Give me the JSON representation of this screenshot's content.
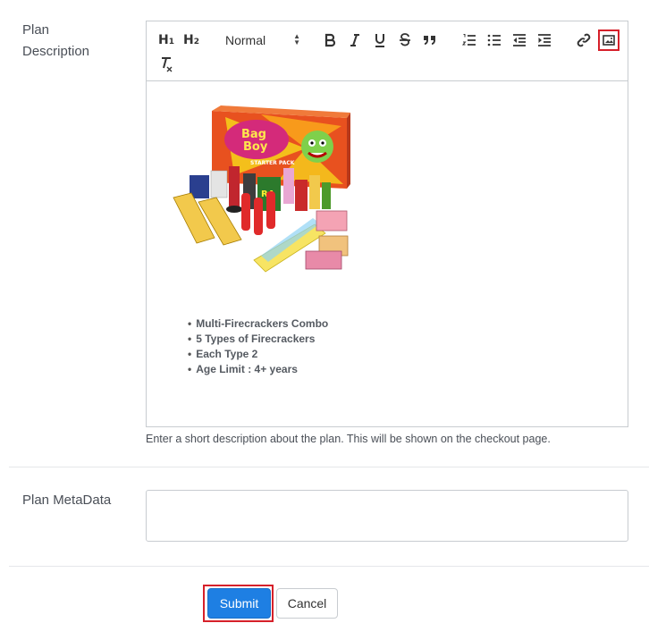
{
  "form": {
    "plan_description_label": "Plan\nDescription",
    "plan_description_help": "Enter a short description about the plan. This will be shown on the checkout page.",
    "plan_metadata_label": "Plan MetaData",
    "plan_metadata_value": "",
    "submit_label": "Submit",
    "cancel_label": "Cancel"
  },
  "toolbar": {
    "h1": "H",
    "h1_sub": "1",
    "h2": "H",
    "h2_sub": "2",
    "format_select": "Normal",
    "icons": [
      "bold-icon",
      "italic-icon",
      "underline-icon",
      "strikethrough-icon",
      "blockquote-icon",
      "ordered-list-icon",
      "bullet-list-icon",
      "outdent-icon",
      "indent-icon",
      "link-icon",
      "image-icon",
      "clear-format-icon"
    ]
  },
  "editor_content": {
    "bullets": [
      "Multi-Firecrackers Combo",
      "5 Types of Firecrackers",
      "Each Type 2",
      "Age Limit : 4+ years"
    ],
    "image_text": {
      "line1": "Bag",
      "line2": "Boy",
      "line3": "STARTER PACK"
    }
  },
  "colors": {
    "primary_button": "#1e7fe3",
    "highlight": "#d6202a"
  }
}
